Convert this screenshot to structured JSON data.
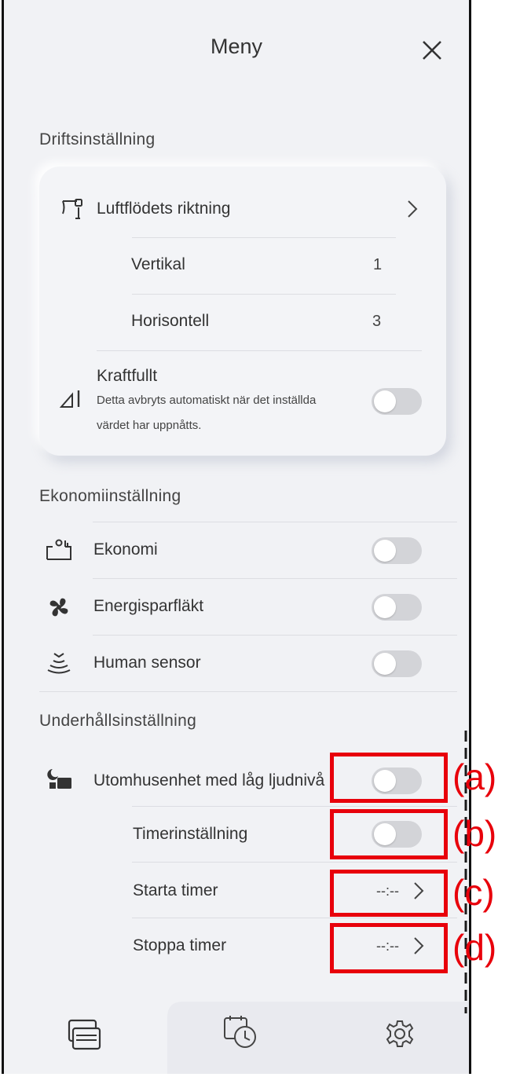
{
  "header": {
    "title": "Meny",
    "close_icon": "close-icon"
  },
  "drift": {
    "section_title": "Driftsinställning",
    "airflow": {
      "label": "Luftflödets riktning",
      "icon": "airflow-direction-icon"
    },
    "vertical": {
      "label": "Vertikal",
      "value": "1"
    },
    "horizontal": {
      "label": "Horisontell",
      "value": "3"
    },
    "powerful": {
      "label": "Kraftfullt",
      "desc_line1": "Detta avbryts automatiskt när det inställda",
      "desc_line2": "värdet har uppnåtts.",
      "on": false
    }
  },
  "eco": {
    "section_title": "Ekonomiinställning",
    "items": [
      {
        "label": "Ekonomi",
        "icon": "economy-icon",
        "on": false
      },
      {
        "label": "Energisparfläkt",
        "icon": "fan-icon",
        "on": false
      },
      {
        "label": "Human sensor",
        "icon": "human-sensor-icon",
        "on": false
      }
    ]
  },
  "maint": {
    "section_title": "Underhållsinställning",
    "outdoor": {
      "label": "Utomhusenhet med låg ljudnivå",
      "on": false
    },
    "timer_setting": {
      "label": "Timerinställning",
      "on": false
    },
    "start_timer": {
      "label": "Starta timer",
      "value": "--:--"
    },
    "stop_timer": {
      "label": "Stoppa timer",
      "value": "--:--"
    }
  },
  "annotations": {
    "a": "(a)",
    "b": "(b)",
    "c": "(c)",
    "d": "(d)"
  },
  "nav": {
    "tabs": [
      "remote-tab",
      "timer-tab",
      "settings-tab"
    ],
    "active": "remote-tab"
  },
  "colors": {
    "annotation": "#e8000b",
    "toggle_off": "#d3d4d8",
    "background": "#f1f2f5"
  }
}
